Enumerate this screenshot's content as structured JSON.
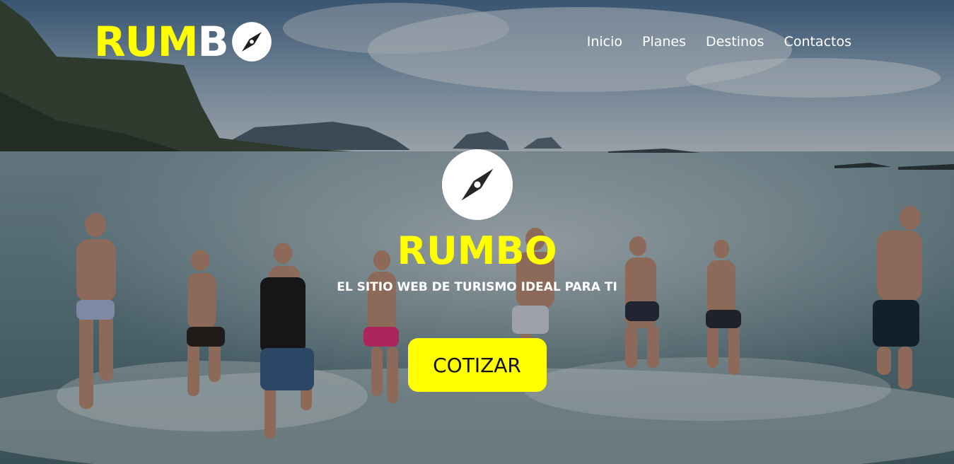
{
  "header": {
    "logo": {
      "text_part1": "RUM",
      "text_part2": "B",
      "icon": "compass-icon"
    },
    "nav": [
      {
        "label": "Inicio"
      },
      {
        "label": "Planes"
      },
      {
        "label": "Destinos"
      },
      {
        "label": "Contactos"
      }
    ]
  },
  "hero": {
    "background_image": "beach-people-running-into-sea",
    "icon": "compass-icon",
    "title": "RUMBO",
    "subtitle": "EL SITIO WEB DE TURISMO IDEAL PARA TI",
    "cta_label": "COTIZAR"
  },
  "colors": {
    "accent": "#ffff00",
    "text_light": "#ffffff",
    "button_text": "#111111"
  }
}
